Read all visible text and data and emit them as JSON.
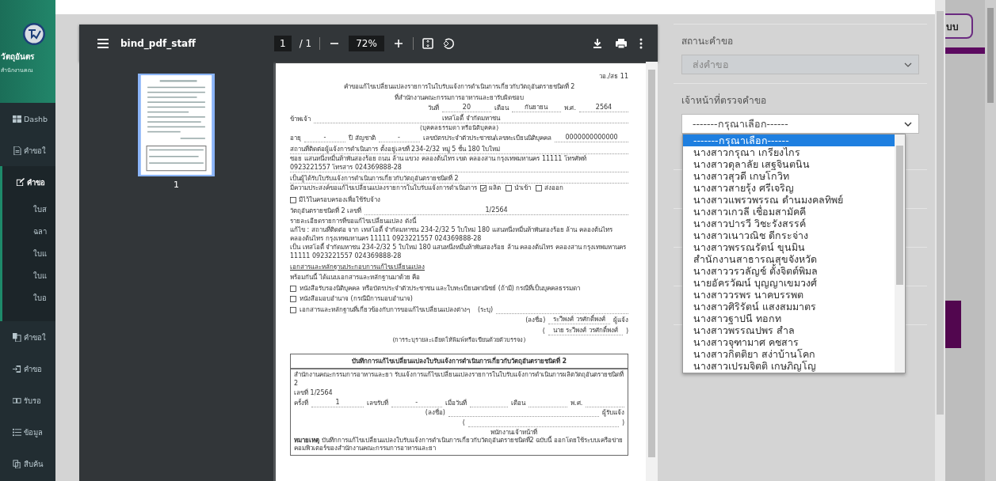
{
  "sidebar": {
    "brand": "วัตถุอันตร",
    "subtitle": "สำนักงานคณ",
    "items": [
      {
        "label": "Dashb",
        "selected": false
      },
      {
        "label": "คำขอใ",
        "selected": false
      },
      {
        "label": "คำขอ",
        "selected": true,
        "expanded": true,
        "children": [
          {
            "label": "ใบส"
          },
          {
            "label": "ฉลา"
          },
          {
            "label": "ใบแ"
          },
          {
            "label": "ใบแ"
          },
          {
            "label": "ใบอ"
          }
        ]
      },
      {
        "label": "คำขอใ",
        "selected": false
      },
      {
        "label": "คำขอ",
        "selected": false
      },
      {
        "label": "รับรอ",
        "selected": false
      },
      {
        "label": "ข้อมูล",
        "selected": false
      },
      {
        "label": "สืบค้น",
        "selected": false
      }
    ]
  },
  "viewer": {
    "filename": "bind_pdf_staff",
    "page": "1",
    "page_total": "/ 1",
    "zoom": "72%",
    "thumbnail_label": "1"
  },
  "document": {
    "sections": [
      {
        "kind": "plain",
        "lines": [
          {
            "kind": "code",
            "text": "วอ./สธ 11"
          },
          {
            "kind": "title",
            "text": "คำขอแก้ไขเปลี่ยนแปลงรายการในใบรับแจ้งการดำเนินการเกี่ยวกับวัตถุอันตรายชนิดที่ 2"
          },
          {
            "kind": "title",
            "text": "ที่สำนักงานคณะกรรมการอาหารและยารับผิดชอบ"
          },
          {
            "kind": "fill-right",
            "parts": [
              {
                "kind": "label",
                "text": "วันที่"
              },
              {
                "kind": "value",
                "text": "20"
              },
              {
                "kind": "label",
                "text": "เดือน"
              },
              {
                "kind": "value",
                "text": "กันยายน"
              },
              {
                "kind": "label",
                "text": "พ.ศ."
              },
              {
                "kind": "value",
                "text": "2564"
              }
            ]
          },
          {
            "kind": "fill",
            "parts": [
              {
                "kind": "label",
                "text": "ข้าพเจ้า"
              },
              {
                "kind": "value",
                "text": "เทสโอดี้ จำกัดมหาชน"
              }
            ]
          },
          {
            "kind": "caption",
            "text": "(บุคคลธรรมดา หรือนิติบุคคล)"
          },
          {
            "kind": "fill",
            "parts": [
              {
                "kind": "label",
                "text": "อายุ"
              },
              {
                "kind": "value",
                "text": "-"
              },
              {
                "kind": "label",
                "text": "ปี สัญชาติ"
              },
              {
                "kind": "value",
                "text": "-"
              },
              {
                "kind": "label",
                "text": "เลขบัตรประจำตัวประชาชน/เลขทะเบียนนิติบุคคล"
              },
              {
                "kind": "value",
                "text": "0000000000000"
              }
            ]
          },
          {
            "kind": "entry",
            "text": "สถานที่ติดต่อผู้แจ้งการดำเนินการ ตั้งอยู่เลขที่ 234-2/32 หมู่ 5 ชั้น 180 ใบใหม่"
          },
          {
            "kind": "entry",
            "text": "ซอย แสนหนึ่งหมื่นห้าพันสองร้อย ถนน ล้าน แขวง คลองต้นไทร เขต คลองสาน กรุงเทพมหานคร 11111 โทรศัพท์ 0923221557 โทรสาร 024369888-28"
          },
          {
            "kind": "entry",
            "text": "เป็นผู้ได้รับใบรับแจ้งการดำเนินการเกี่ยวกับวัตถุอันตรายชนิดที่ 2"
          },
          {
            "kind": "choices",
            "text": "มีความประสงค์ขอแก้ไขเปลี่ยนแปลงรายการในใบรับแจ้งการดำเนินการ",
            "options": [
              {
                "label": "ผลิต",
                "checked": true
              },
              {
                "label": "นำเข้า",
                "checked": false
              },
              {
                "label": "ส่งออก",
                "checked": false
              },
              {
                "label": "มีไว้ในครอบครองเพื่อใช้รับจ้าง",
                "checked": false
              }
            ]
          },
          {
            "kind": "fill",
            "parts": [
              {
                "kind": "label",
                "text": "วัตถุอันตรายชนิดที่ 2 เลขที่"
              },
              {
                "kind": "value",
                "text": "1/2564"
              }
            ]
          },
          {
            "kind": "text",
            "text": "รายละเอียดรายการที่ขอแก้ไขเปลี่ยนแปลง ดังนี้"
          },
          {
            "kind": "text",
            "text": "แก้ไข : สถานที่ติดต่อ จาก  เทสโอดี้ จำกัดมหาชน 234-2/32 5  ใบใหม่ 180 แสนหนึ่งหมื่นห้าพันสองร้อย ล้าน คลองต้นไทร คลองต้นไทร กรุงเทพมหานคร 11111 0923221557 024369888-28"
          },
          {
            "kind": "text",
            "text": " เป็น  เทสโอดี้ จำกัดมหาชน 234-2/32 5  ใบใหม่ 180 แสนหนึ่งหมื่นห้าพันสองร้อย ล้าน คลองต้นไทร คลองสาน กรุงเทพมหานคร 11111 0923221557 024369888-28"
          },
          {
            "kind": "heading",
            "text": "เอกสารและหลักฐานประกอบการแก้ไขเปลี่ยนแปลง"
          },
          {
            "kind": "text",
            "text": "พร้อมกันนี้ ได้แนบเอกสารและหลักฐานมาด้วย คือ"
          },
          {
            "kind": "check",
            "text": "หนังสือรับรองนิติบุคคล หรือบัตรประจำตัวประชาชน และใบทะเบียนพาณิชย์ (ถ้ามี) กรณีที่เป็นบุคคลธรรมดา",
            "checked": false
          },
          {
            "kind": "check",
            "text": "หนังสือมอบอำนาจ (กรณีมีการมอบอำนาจ)",
            "checked": false
          },
          {
            "kind": "check",
            "text": "เอกสารและหลักฐานที่เกี่ยวข้องกับการขอแก้ไขเปลี่ยนแปลงต่างๆ",
            "suffix": "(ระบุ)",
            "checked": false
          },
          {
            "kind": "fill-right",
            "parts": [
              {
                "kind": "label",
                "text": "(ลงชื่อ)"
              },
              {
                "kind": "value",
                "text": "ระวีพงศ์ วรศักดิ์พงศ์"
              },
              {
                "kind": "label",
                "text": "ผู้แจ้ง"
              }
            ]
          },
          {
            "kind": "fill-right",
            "parts": [
              {
                "kind": "label",
                "text": "("
              },
              {
                "kind": "value",
                "text": "นาย ระวีพงศ์ วรศักดิ์พงศ์"
              },
              {
                "kind": "label",
                "text": ")"
              }
            ]
          },
          {
            "kind": "caption",
            "text": "(การระบุรายละเอียดให้พิมพ์หรือเขียนด้วยตัวบรรจง)"
          }
        ]
      },
      {
        "kind": "boxed",
        "title": "บันทึกการแก้ไขเปลี่ยนแปลงใบรับแจ้งการดำเนินการเกี่ยวกับวัตถุอันตรายชนิดที่ 2",
        "lines": [
          {
            "kind": "text",
            "text": "สำนักงานคณะกรรมการอาหารและยา รับแจ้งการแก้ไขเปลี่ยนแปลงรายการในใบรับแจ้งการดำเนินการผลิตวัตถุอันตรายชนิดที่ 2"
          },
          {
            "kind": "text",
            "text": "เลขที่ 1/2564"
          },
          {
            "kind": "fill",
            "parts": [
              {
                "kind": "label",
                "text": "ครั้งที่"
              },
              {
                "kind": "value",
                "text": "1"
              },
              {
                "kind": "label",
                "text": "เลขรับที่"
              },
              {
                "kind": "value",
                "text": "-"
              },
              {
                "kind": "label",
                "text": "เมื่อวันที่"
              },
              {
                "kind": "blank"
              },
              {
                "kind": "label",
                "text": "เดือน"
              },
              {
                "kind": "blank"
              },
              {
                "kind": "label",
                "text": "พ.ศ."
              },
              {
                "kind": "blank"
              }
            ]
          },
          {
            "kind": "fill-right",
            "parts": [
              {
                "kind": "label",
                "text": "(ลงชื่อ)"
              },
              {
                "kind": "blank"
              },
              {
                "kind": "label",
                "text": "ผู้รับแจ้ง"
              }
            ]
          },
          {
            "kind": "fill-right",
            "parts": [
              {
                "kind": "label",
                "text": "("
              },
              {
                "kind": "blank"
              },
              {
                "kind": "label",
                "text": ")"
              }
            ]
          },
          {
            "kind": "signer",
            "text": "พนักงานเจ้าหน้าที่"
          },
          {
            "kind": "remark",
            "text": "**หมายเหตุ** บันทึกการแก้ไขเปลี่ยนแปลงใบรับแจ้งการดำเนินการเกี่ยวกับวัตถุอันตรายชนิดที่2 ฉบับนี้ ออกโดยใช้ระบบเครือข่ายคอมพิวเตอร์ของสำนักงานคณะกรรมการอาหารและยา"
          }
        ]
      }
    ]
  },
  "form": {
    "status": {
      "label": "สถานะคำขอ",
      "value": "ส่งคำขอ",
      "disabled": true
    },
    "officer": {
      "label": "เจ้าหน้าที่ตรวจคำขอ",
      "value": "-------กรุณาเลือก------",
      "expanded": true,
      "options": [
        {
          "label": "-------กรุณาเลือก------",
          "selected": true
        },
        {
          "label": "นางสาวกรุณา เกรียงไกร",
          "selected": false
        },
        {
          "label": "นางสาวดุลาลัย เสฐจินตนิน",
          "selected": false
        },
        {
          "label": "นางสาวสุวดี เกษโกวิท",
          "selected": false
        },
        {
          "label": "นางสาวสายรุ้ง ศรีเจริญ",
          "selected": false
        },
        {
          "label": "นางสาวแพรวพรรณ ดำนมงคลทิพย์",
          "selected": false
        },
        {
          "label": "นางสาวเกวลี เชื่อมสามัคคี",
          "selected": false
        },
        {
          "label": "นางสาวปารวี วิชะรังสรรค์",
          "selected": false
        },
        {
          "label": "นางสาวเนาวณิช ดีกระจ่าง",
          "selected": false
        },
        {
          "label": "นางสาวพรรณรัตน์ ขุนมิน",
          "selected": false
        },
        {
          "label": "สำนักงานสาธารณสุขจังหวัด",
          "selected": false
        },
        {
          "label": "นางสาววรวลัญช์ ตั้งจิตต์พิมล",
          "selected": false
        },
        {
          "label": "นายอัครวัฒน์ บุญญาเขมวงศ์",
          "selected": false
        },
        {
          "label": "นางสาววรพร นาคบรรพต",
          "selected": false
        },
        {
          "label": "นางสาวศิริรัตน์ แสงสมมาตร",
          "selected": false
        },
        {
          "label": "นางสาวฐาปนี ทอกท",
          "selected": false
        },
        {
          "label": "นางสาวพรรณปพร สำล",
          "selected": false
        },
        {
          "label": "นางสาวจุฑามาศ คชสาร",
          "selected": false
        },
        {
          "label": "นางสาวกิตติยา สง่าบ้านโคก",
          "selected": false
        },
        {
          "label": "นางสาวเปรมจิตติ เกษภิญโญ",
          "selected": false
        }
      ]
    }
  },
  "background": {
    "button_label": "บบ"
  }
}
